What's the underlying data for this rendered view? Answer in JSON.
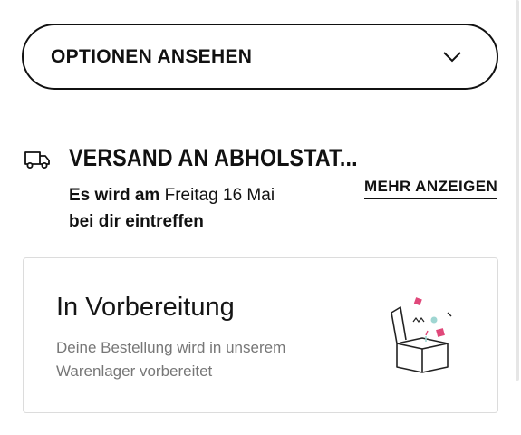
{
  "options": {
    "label": "OPTIONEN ANSEHEN",
    "icon": "chevron-down-icon"
  },
  "shipping": {
    "icon": "truck-icon",
    "title": "VERSAND AN ABHOLSTAT...",
    "delivery_prefix": "Es wird am",
    "delivery_date": "Freitag 16 Mai",
    "delivery_suffix": "bei dir eintreffen",
    "more_link": "MEHR ANZEIGEN"
  },
  "status_card": {
    "title": "In Vorbereitung",
    "description": "Deine Bestellung wird in unserem Warenlager vorbereitet",
    "illustration": "open-box-illustration",
    "colors": {
      "accent_pink": "#e0487a",
      "accent_teal": "#9fd6d2"
    }
  }
}
